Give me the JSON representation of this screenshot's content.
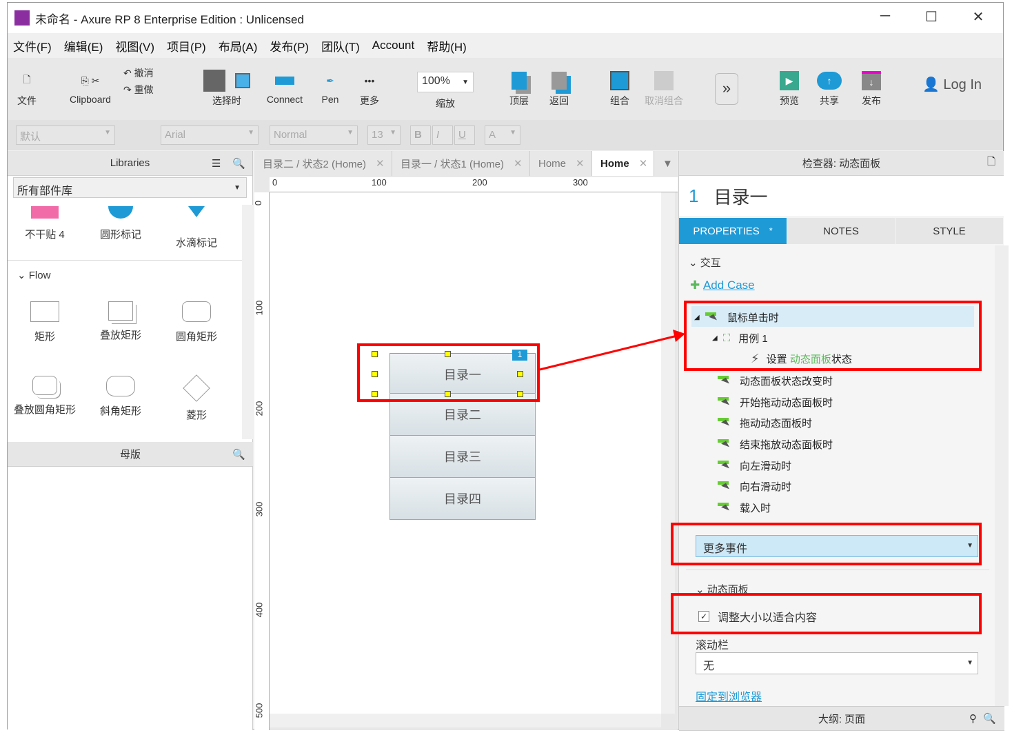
{
  "window": {
    "title": "未命名 - Axure RP 8 Enterprise Edition : Unlicensed",
    "minimize": "─",
    "maximize": "☐",
    "close": "✕"
  },
  "menu": [
    "文件(F)",
    "编辑(E)",
    "视图(V)",
    "项目(P)",
    "布局(A)",
    "发布(P)",
    "团队(T)",
    "Account",
    "帮助(H)"
  ],
  "toolbar": {
    "file": "文件",
    "clipboard": "Clipboard",
    "undo": "撤消",
    "redo": "重做",
    "select_mode": "选择时",
    "connect": "Connect",
    "pen": "Pen",
    "more": "更多",
    "zoom_value": "100%",
    "zoom_label": "缩放",
    "front": "顶层",
    "back": "返回",
    "group": "组合",
    "ungroup": "取消组合",
    "preview": "预览",
    "share": "共享",
    "publish": "发布",
    "login": "Log In"
  },
  "format": {
    "style": "默认",
    "font": "Arial",
    "weight": "Normal",
    "size": "13",
    "bold": "B",
    "italic": "I",
    "underline": "U",
    "fontcolor": "A"
  },
  "libraries": {
    "title": "Libraries",
    "selector": "所有部件库",
    "top_items": [
      "不干贴 4",
      "圆形标记",
      "水滴标记"
    ],
    "group": "Flow",
    "items": [
      "矩形",
      "叠放矩形",
      "圆角矩形",
      "叠放圆角矩形",
      "斜角矩形",
      "菱形"
    ]
  },
  "masters": {
    "title": "母版"
  },
  "tabs": [
    {
      "label": "目录二 / 状态2 (Home)"
    },
    {
      "label": "目录一 / 状态1 (Home)"
    },
    {
      "label": "Home"
    },
    {
      "label": "Home",
      "active": true
    }
  ],
  "ruler": {
    "h": [
      "0",
      "100",
      "200",
      "300"
    ],
    "v": [
      "0",
      "100",
      "200",
      "300",
      "400",
      "500"
    ]
  },
  "canvas": {
    "badge": "1",
    "panels": [
      "目录一",
      "目录二",
      "目录三",
      "目录四"
    ]
  },
  "inspector": {
    "title": "检查器: 动态面板",
    "widget_number": "1",
    "widget_name": "目录一",
    "tabs": [
      "PROPERTIES",
      "NOTES",
      "STYLE"
    ],
    "tab_modified": "*",
    "interaction_section": "交互",
    "add_case": "Add Case",
    "event_selected": "鼠标单击时",
    "case": "用例 1",
    "action_prefix": "设置",
    "action_target": "动态面板",
    "action_suffix": "状态",
    "events": [
      "动态面板状态改变时",
      "开始拖动动态面板时",
      "拖动动态面板时",
      "结束拖放动态面板时",
      "向左滑动时",
      "向右滑动时",
      "载入时"
    ],
    "more_events": "更多事件",
    "panel_section": "动态面板",
    "fit_content": "调整大小以适合内容",
    "fit_checked": true,
    "scrollbar_label": "滚动栏",
    "scrollbar_value": "无",
    "pin": "固定到浏览器"
  },
  "outline": {
    "title": "大纲: 页面"
  },
  "colors": {
    "accent": "#1e9ad6",
    "highlight": "#f00",
    "green": "#5cb85c"
  }
}
